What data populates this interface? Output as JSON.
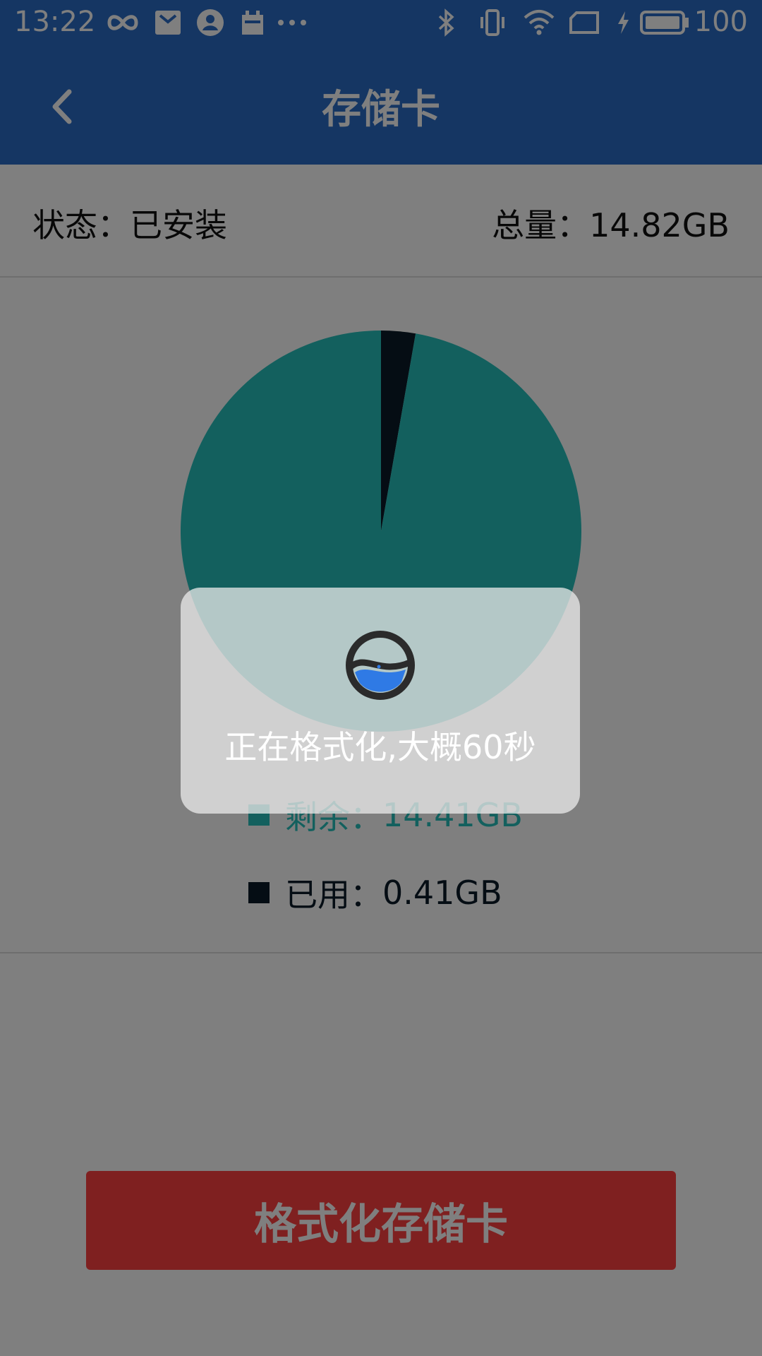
{
  "status_bar": {
    "time": "13:22",
    "battery": "100",
    "icons": [
      "infinity-icon",
      "mail-icon",
      "account-icon",
      "calendar-icon",
      "more-icon",
      "bluetooth-icon",
      "vibrate-icon",
      "wifi-icon",
      "sim-icon",
      "charging-icon",
      "battery-icon"
    ]
  },
  "app_bar": {
    "title": "存储卡",
    "back_icon": "chevron-left-icon"
  },
  "info": {
    "status_label": "状态：",
    "status_value": "已安装",
    "total_label": "总量：",
    "total_value": "14.82GB"
  },
  "chart_data": {
    "type": "pie",
    "slices": [
      {
        "name": "剩余",
        "value": 14.41,
        "color": "#26c1bd"
      },
      {
        "name": "已用",
        "value": 0.41,
        "color": "#0a1a28"
      }
    ]
  },
  "legend": {
    "remaining_label": "剩余：",
    "remaining_value": "14.41GB",
    "used_label": "已用：",
    "used_value": "0.41GB"
  },
  "format_button": {
    "label": "格式化存储卡",
    "color": "#fe4040"
  },
  "toast": {
    "message": "正在格式化,大概60秒"
  }
}
